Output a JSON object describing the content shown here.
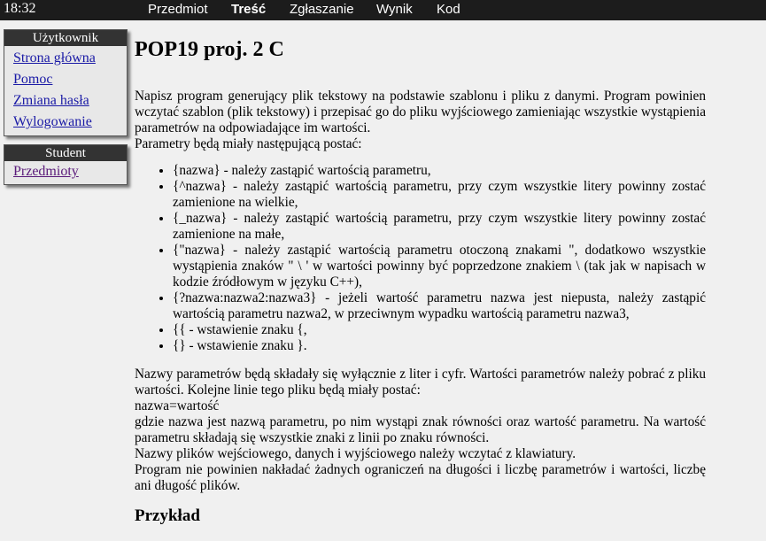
{
  "topbar": {
    "clock": "18:32",
    "nav": [
      "Przedmiot",
      "Treść",
      "Zgłaszanie",
      "Wynik",
      "Kod"
    ],
    "active_tab": "Treść"
  },
  "sidebar": {
    "user": {
      "title": "Użytkownik",
      "links": [
        "Strona główna",
        "Pomoc",
        "Zmiana hasła",
        "Wylogowanie"
      ]
    },
    "student": {
      "title": "Student",
      "links": [
        "Przedmioty"
      ]
    }
  },
  "content": {
    "title": "POP19 proj. 2 C",
    "intro": "Napisz program generujący plik tekstowy na podstawie szablonu i pliku z danymi. Program powinien wczytać szablon (plik tekstowy) i przepisać go do pliku wyjściowego zamieniając wszystkie wystąpienia parametrów na odpowiadające im wartości.",
    "params_intro": "Parametry będą miały następującą postać:",
    "params": [
      "{nazwa} - należy zastąpić wartością parametru,",
      "{^nazwa} - należy zastąpić wartością parametru, przy czym wszystkie litery powinny zostać zamienione na wielkie,",
      "{_nazwa} - należy zastąpić wartością parametru, przy czym wszystkie litery powinny zostać zamienione na małe,",
      "{\"nazwa} - należy zastąpić wartością parametru otoczoną znakami \", dodatkowo wszystkie wystąpienia znaków \" \\ ' w wartości powinny być poprzedzone znakiem \\ (tak jak w napisach w kodzie źródłowym w języku C++),",
      "{?nazwa:nazwa2:nazwa3} - jeżeli wartość parametru nazwa jest niepusta, należy zastąpić wartością parametru nazwa2, w przeciwnym wypadku wartością parametru nazwa3,",
      "{{ - wstawienie znaku {,",
      "{} - wstawienie znaku }."
    ],
    "names_text": "Nazwy parametrów będą składały się wyłącznie z liter i cyfr. Wartości parametrów należy pobrać z pliku wartości. Kolejne linie tego pliku będą miały postać:",
    "format_line": "nazwa=wartość",
    "format_desc": "gdzie nazwa jest nazwą parametru, po nim wystąpi znak równości oraz wartość parametru. Na wartość parametru składają się wszystkie znaki z linii po znaku równości.",
    "files_text": "Nazwy plików wejściowego, danych i wyjściowego należy wczytać z klawiatury.",
    "limits_text": "Program nie powinien nakładać żadnych ograniczeń na długości i liczbę parametrów i wartości, liczbę ani długość plików.",
    "example_heading": "Przykład"
  }
}
